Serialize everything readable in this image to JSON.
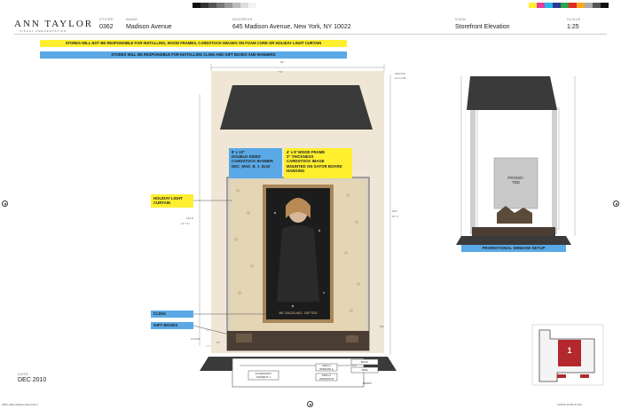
{
  "header": {
    "brand": "ANN TAYLOR",
    "brand_sub": "VISUAL PRESENTATION",
    "store_label": "STORE",
    "store_value": "0362",
    "name_label": "NAME",
    "name_value": "Madison Avenue",
    "address_label": "ADDRESS",
    "address_value": "645 Madison Avenue, New York, NY 10022",
    "view_label": "VIEW",
    "view_value": "Storefront Elevation",
    "scale_label": "SCALE",
    "scale_value": "1:25"
  },
  "banners": {
    "yellow": "STORES WILL NOT BE RESPONSIBLE FOR INSTALLING, WOOD FRAMES, CARDSTOCK IMAGES ON FOAM CORE OR HOLIDAY LIGHT CURTAIN",
    "blue": "STORES WILL BE RESPONSIBLE FOR INSTALLING CLING AND GIFT BOXES AND BANNERS"
  },
  "callouts": {
    "banner_note": "8' x 10\"\nDOUBLE-SIDED\nCARDSTOCK BANNER\nDEC_MAD_B_1_8x10",
    "frame_note": "4' x 8' WOOD FRAME\n3\" THICKNESS\nCARDSTOCK IMAGE\nMOUNTED ON GATOR BOARD\nHANGING",
    "holiday_light": "HOLIDAY LIGHT\nCURTAIN",
    "cling": "CLING",
    "gift_boxes": "GIFT BOXES",
    "poster_text": "BE DAZZLING. GIFTED"
  },
  "dimensions": {
    "top_width": "90\"",
    "top_width_2": "7' 6\"",
    "height_left": "139.5\"",
    "height_left_2": "11' 7.5\"",
    "height_right": "184\"",
    "height_right_2": "15' 4\"",
    "ceiling": "CEILING",
    "ceiling_2": "13' 11.25\"",
    "floor_left": "12\"",
    "floor_left_2": "FLOOR",
    "na": "N/A"
  },
  "promo": {
    "label": "PROMO:\nTBD",
    "setup": "PROMOTIONAL WINDOW SETUP"
  },
  "plan": {
    "accessory": "ACCESSORY\nMOMENT 1",
    "main1": "MAIN 1\nWINDOW A",
    "main2": "MAIN 2\nWINDOW B",
    "back": "BACK",
    "front": "FRONT",
    "side": "SIDE"
  },
  "location_map": {
    "number": "1"
  },
  "footer": {
    "date_label": "DATE",
    "date_value": "DEC 2010",
    "file_name": "0362_DEC Madisonhow.indd   1",
    "timestamp": "11/5/10   10:56:07 AM"
  },
  "colors": {
    "yellow": "#ffef2e",
    "blue": "#5aa9e6",
    "awning": "#3a3a3a",
    "wall": "#efe6d6",
    "frame_gold": "#a8875a"
  }
}
